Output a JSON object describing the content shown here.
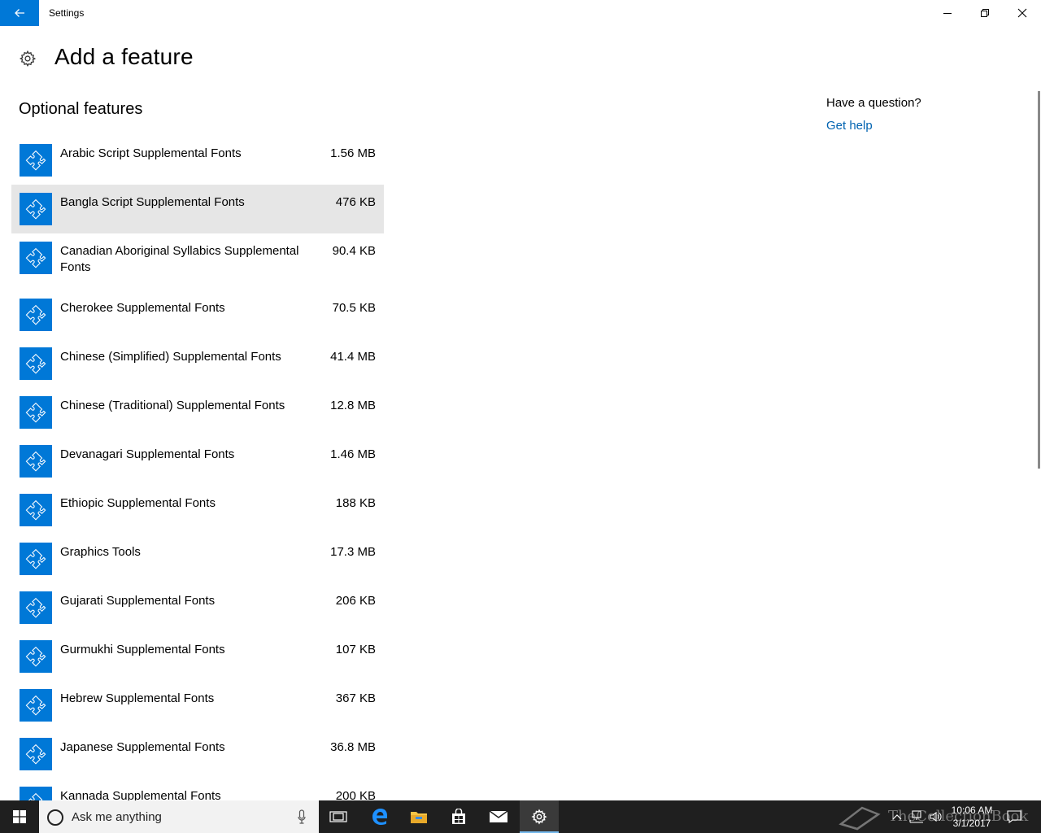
{
  "window": {
    "title": "Settings"
  },
  "header": {
    "title": "Add a feature"
  },
  "section": {
    "title": "Optional features"
  },
  "features": [
    {
      "name": "Arabic Script Supplemental Fonts",
      "size": "1.56 MB"
    },
    {
      "name": "Bangla Script Supplemental Fonts",
      "size": "476 KB",
      "selected": true
    },
    {
      "name": "Canadian Aboriginal Syllabics Supplemental Fonts",
      "size": "90.4 KB"
    },
    {
      "name": "Cherokee Supplemental Fonts",
      "size": "70.5 KB"
    },
    {
      "name": "Chinese (Simplified) Supplemental Fonts",
      "size": "41.4 MB"
    },
    {
      "name": "Chinese (Traditional) Supplemental Fonts",
      "size": "12.8 MB"
    },
    {
      "name": "Devanagari Supplemental Fonts",
      "size": "1.46 MB"
    },
    {
      "name": "Ethiopic Supplemental Fonts",
      "size": "188 KB"
    },
    {
      "name": "Graphics Tools",
      "size": "17.3 MB"
    },
    {
      "name": "Gujarati Supplemental Fonts",
      "size": "206 KB"
    },
    {
      "name": "Gurmukhi Supplemental Fonts",
      "size": "107 KB"
    },
    {
      "name": "Hebrew Supplemental Fonts",
      "size": "367 KB"
    },
    {
      "name": "Japanese Supplemental Fonts",
      "size": "36.8 MB"
    },
    {
      "name": "Kannada Supplemental Fonts",
      "size": "200 KB"
    }
  ],
  "help": {
    "question": "Have a question?",
    "link": "Get help"
  },
  "taskbar": {
    "search_placeholder": "Ask me anything",
    "time": "10:06 AM",
    "date": "3/1/2017",
    "watermark": "TheCollectionBook"
  },
  "icons": {
    "feature": "puzzle-icon",
    "page": "gear-icon",
    "back": "arrow-left-icon"
  },
  "colors": {
    "accent": "#0078d7",
    "link": "#0063b1",
    "selected_row": "#e6e6e6",
    "taskbar": "#1f1f1f"
  }
}
